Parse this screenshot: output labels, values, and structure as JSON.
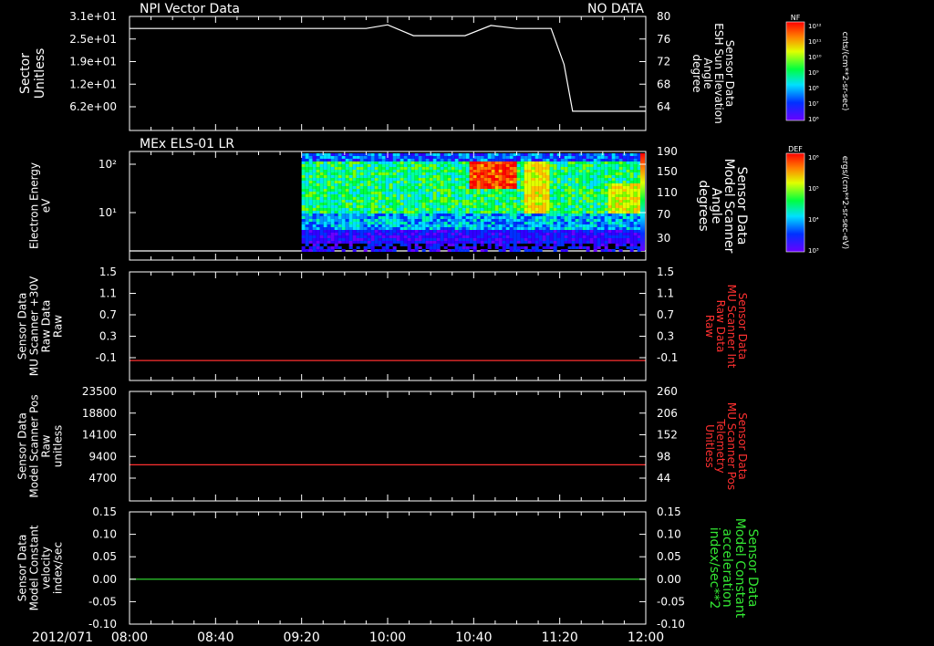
{
  "time_axis": {
    "date_label": "2012/071",
    "ticks": [
      "08:00",
      "08:40",
      "09:20",
      "10:00",
      "10:40",
      "11:20",
      "12:00"
    ]
  },
  "chart_data": [
    {
      "type": "line",
      "title": "NPI Vector Data",
      "status": "NO DATA",
      "left_label": [
        "Sector",
        "Unitless"
      ],
      "left_ticks": [
        "3.1e+01",
        "2.5e+01",
        "1.9e+01",
        "1.2e+01",
        "6.2e+00"
      ],
      "right_label": [
        "Sensor Data",
        "ESH Sun Elevation",
        "Angle",
        "degree"
      ],
      "right_ticks": [
        "80",
        "76",
        "72",
        "68",
        "64"
      ],
      "ylim": [
        61,
        80
      ],
      "series": [
        {
          "x": [
            "08:00",
            "09:36",
            "09:50",
            "10:00",
            "10:12",
            "10:28",
            "10:36",
            "10:48",
            "11:00",
            "11:16",
            "11:22",
            "11:26",
            "12:00"
          ],
          "values": [
            78.0,
            78.0,
            78.0,
            78.6,
            76.8,
            76.8,
            76.8,
            78.5,
            78.0,
            78.0,
            72.0,
            64.2,
            64.2
          ]
        }
      ]
    },
    {
      "type": "heatmap",
      "title": "MEx ELS-01 LR",
      "left_label": [
        "Electron Energy",
        "eV"
      ],
      "left_ticks": [
        "10²",
        "10¹"
      ],
      "right_label": [
        "Sensor Data",
        "Model Scanner",
        "Angle",
        "degrees"
      ],
      "right_ticks": [
        "190",
        "150",
        "110",
        "70",
        "30"
      ],
      "data_start": "09:20",
      "colorbar": {
        "label": "DEF",
        "units": "ergs/(cm**2-sr-sec-eV)",
        "ticks": [
          "10⁶",
          "10⁵",
          "10⁴",
          "10³"
        ]
      }
    },
    {
      "type": "line",
      "left_label": [
        "Sensor Data",
        "MU Scanner +30V",
        "Raw Data",
        "Raw"
      ],
      "left_ticks": [
        "1.5",
        "1.1",
        "0.7",
        "0.3",
        "-0.1"
      ],
      "right_label": [
        "Sensor Data",
        "MU Scanner Int",
        "Raw Data",
        "Raw"
      ],
      "right_ticks": [
        "1.5",
        "1.1",
        "0.7",
        "0.3",
        "-0.1"
      ],
      "ylim": [
        -0.4,
        1.5
      ],
      "series": [
        {
          "x": [
            "08:00",
            "12:00"
          ],
          "values": [
            -0.05,
            -0.05
          ],
          "color": "#ff3030"
        }
      ]
    },
    {
      "type": "line",
      "left_label": [
        "Sensor Data",
        "Model Scanner Pos",
        "Raw",
        "unitless"
      ],
      "left_ticks": [
        "23500",
        "18800",
        "14100",
        "9400",
        "4700"
      ],
      "right_label": [
        "Sensor Data",
        "MU Scanner Pos",
        "Telemetry",
        "Unitless"
      ],
      "right_ticks": [
        "260",
        "206",
        "152",
        "98",
        "44"
      ],
      "ylim": [
        0,
        23500
      ],
      "series": [
        {
          "x": [
            "08:00",
            "12:00"
          ],
          "values": [
            7750,
            7750
          ],
          "color": "#ff3030"
        }
      ]
    },
    {
      "type": "line",
      "left_label": [
        "Sensor Data",
        "Model Constant",
        "velocity",
        "index/sec"
      ],
      "left_ticks": [
        "0.15",
        "0.10",
        "0.05",
        "0.00",
        "-0.05",
        "-0.10"
      ],
      "right_label": [
        "Sensor Data",
        "Model Constant",
        "acceleration",
        "index/sec**2"
      ],
      "right_ticks": [
        "0.15",
        "0.10",
        "0.05",
        "0.00",
        "-0.05",
        "-0.10"
      ],
      "ylim": [
        -0.1,
        0.15
      ],
      "series": [
        {
          "x": [
            "08:00",
            "12:00"
          ],
          "values": [
            0.0,
            0.0
          ],
          "color": "#33e633"
        }
      ]
    }
  ],
  "colorbar_nf": {
    "label": "NF",
    "units": "cnts/(cm**2-sr-sec)",
    "ticks": [
      "10¹²",
      "10¹¹",
      "10¹⁰",
      "10⁹",
      "10⁸",
      "10⁷",
      "10⁶"
    ]
  }
}
